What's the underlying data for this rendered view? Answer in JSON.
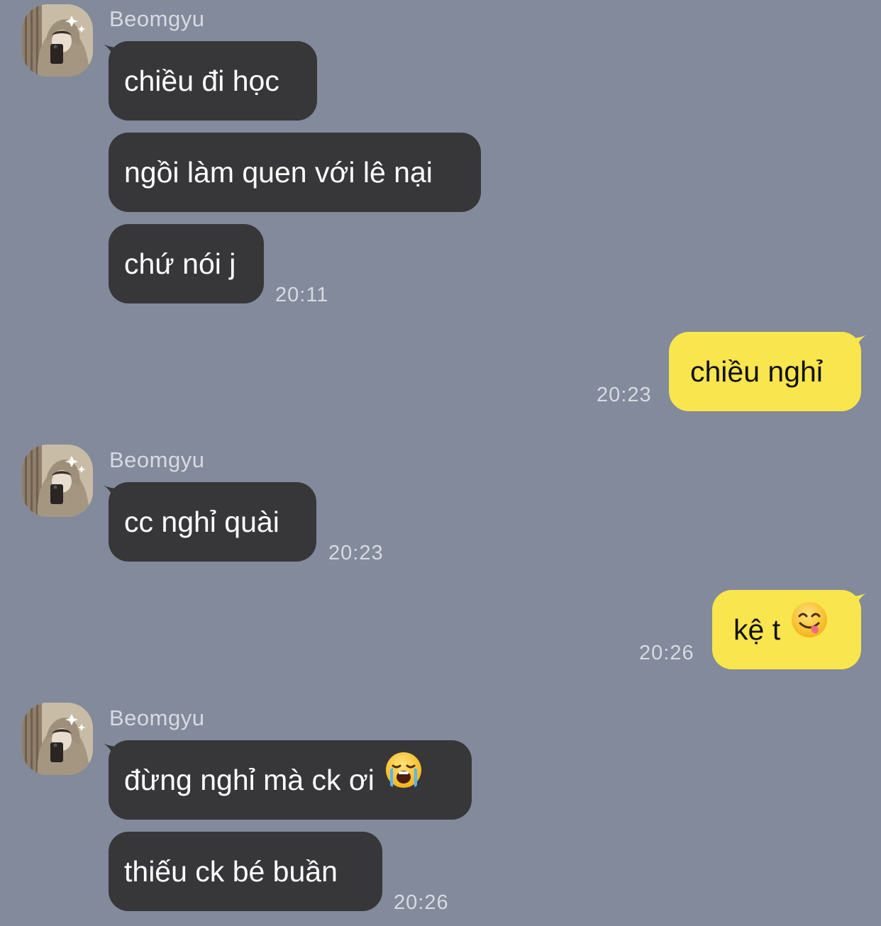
{
  "colors": {
    "background": "#828a9b",
    "incoming_bubble": "#373739",
    "incoming_text": "#ffffff",
    "outgoing_bubble": "#f9e54d",
    "outgoing_text": "#111111",
    "meta_text": "#d7dae2"
  },
  "groups": [
    {
      "sender": "Beomgyu",
      "messages": [
        "chiều đi học",
        "ngồi làm quen với lê nại",
        "chứ nói j"
      ],
      "time": "20:11"
    },
    {
      "outgoing": true,
      "message": "chiều nghỉ",
      "time": "20:23"
    },
    {
      "sender": "Beomgyu",
      "messages": [
        "cc nghỉ quài"
      ],
      "time": "20:23"
    },
    {
      "outgoing": true,
      "message": "kệ t",
      "emoji": "face-savoring-food-emoji",
      "time": "20:26"
    },
    {
      "sender": "Beomgyu",
      "messages": [
        "đừng nghỉ mà ck ơi",
        "thiếu ck bé buần"
      ],
      "emoji": "loudly-crying-face-emoji",
      "time": "20:26"
    }
  ]
}
